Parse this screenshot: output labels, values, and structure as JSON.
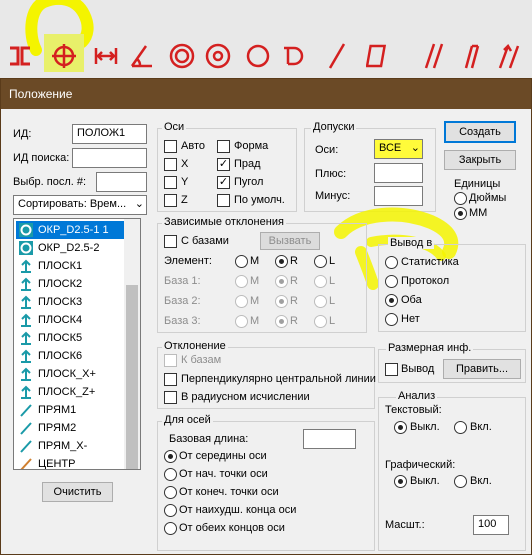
{
  "toolbar": {
    "icons": [
      "cross-hair-grid-icon",
      "circle-crosshair-icon",
      "distance-arrows-icon",
      "angle-icon",
      "concentric-circles-icon",
      "circle-target-icon",
      "circle-icon",
      "profile-icon",
      "slash-line-icon",
      "square-icon",
      "parallel-icon",
      "perpendicular-icon",
      "arrows-icon"
    ]
  },
  "dialog": {
    "title": "Положение",
    "id_label": "ИД:",
    "id_value": "ПОЛОЖ1",
    "search_id_label": "ИД поиска:",
    "search_id_value": "",
    "select_last_label": "Выбр. посл. #:",
    "select_last_value": "",
    "sort_label": "Сортировать: Врем...",
    "list_items": [
      {
        "label": "ОКР_D2.5-1  1",
        "icon": "circle-feature-icon",
        "selected": true
      },
      {
        "label": "ОКР_D2.5-2",
        "icon": "circle-feature-icon",
        "selected": false
      },
      {
        "label": "ПЛОСК1",
        "icon": "plane-feature-icon",
        "selected": false
      },
      {
        "label": "ПЛОСК2",
        "icon": "plane-feature-icon",
        "selected": false
      },
      {
        "label": "ПЛОСК3",
        "icon": "plane-feature-icon",
        "selected": false
      },
      {
        "label": "ПЛОСК4",
        "icon": "plane-feature-icon",
        "selected": false
      },
      {
        "label": "ПЛОСК5",
        "icon": "plane-feature-icon",
        "selected": false
      },
      {
        "label": "ПЛОСК6",
        "icon": "plane-feature-icon",
        "selected": false
      },
      {
        "label": "ПЛОСК_X+",
        "icon": "plane-feature-icon",
        "selected": false
      },
      {
        "label": "ПЛОСК_Z+",
        "icon": "plane-feature-icon",
        "selected": false
      },
      {
        "label": "ПРЯМ1",
        "icon": "line-feature-icon",
        "selected": false
      },
      {
        "label": "ПРЯМ2",
        "icon": "line-feature-icon",
        "selected": false
      },
      {
        "label": "ПРЯМ_X-",
        "icon": "line-feature-icon",
        "selected": false
      },
      {
        "label": "ЦЕНТР",
        "icon": "point-feature-icon",
        "selected": false
      }
    ],
    "clear_button": "Очистить",
    "axes": {
      "title": "Оси",
      "auto": "Авто",
      "form": "Форма",
      "x": "X",
      "prad": "Прад",
      "y": "Y",
      "pugol": "Пугол",
      "z": "Z",
      "default": "По умолч.",
      "prad_checked": true,
      "pugol_checked": true
    },
    "tolerances": {
      "title": "Допуски",
      "axes_label": "Оси:",
      "axes_value": "ВСЕ",
      "plus_label": "Плюс:",
      "minus_label": "Минус:"
    },
    "create_button": "Создать",
    "close_button": "Закрыть",
    "units": {
      "title": "Единицы",
      "inches": "Дюймы",
      "mm": "ММ",
      "selected": "ММ"
    },
    "dependent": {
      "title": "Зависимые отклонения",
      "with_bases": "С базами",
      "call_button": "Вызвать",
      "element_label": "Элемент:",
      "base1_label": "База 1:",
      "base2_label": "База 2:",
      "base3_label": "База 3:",
      "m": "M",
      "r": "R",
      "l": "L"
    },
    "output": {
      "title": "Вывод в",
      "stats": "Статистика",
      "protocol": "Протокол",
      "both": "Оба",
      "none": "Нет",
      "selected": "Оба"
    },
    "deviation": {
      "title": "Отклонение",
      "to_bases": "К базам",
      "perp": "Перпендикулярно центральной линии",
      "radial": "В радиусном исчислении"
    },
    "size_info": {
      "title": "Размерная инф.",
      "output": "Вывод",
      "edit_button": "Править..."
    },
    "for_axes": {
      "title": "Для осей",
      "base_length": "Базовая длина:",
      "opt1": "От середины оси",
      "opt2": "От нач. точки оси",
      "opt3": "От конеч. точки оси",
      "opt4": "От наихудш. конца оси",
      "opt5": "От обеих концов оси"
    },
    "analysis": {
      "title": "Анализ",
      "text_label": "Текстовый:",
      "graphic_label": "Графический:",
      "off": "Выкл.",
      "on": "Вкл.",
      "scale_label": "Масшт.:",
      "scale_value": "100"
    }
  },
  "colors": {
    "accent": "#0078d7",
    "title_bar": "#6b4a26",
    "highlight": "#f4f400",
    "icon_red": "#d42020"
  }
}
